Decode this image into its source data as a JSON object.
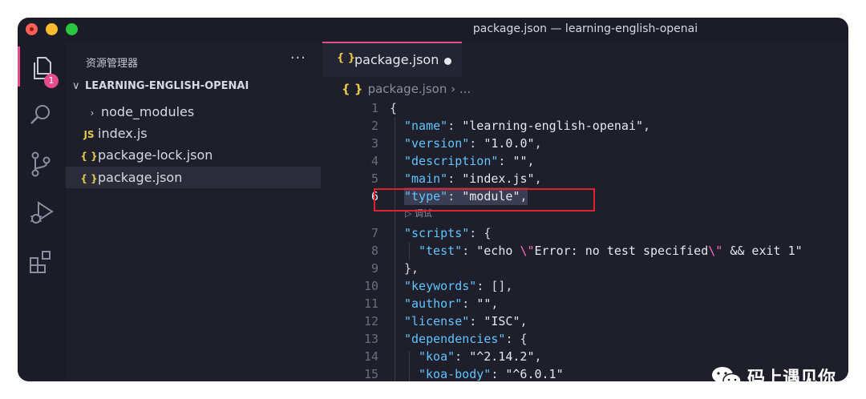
{
  "window": {
    "title": "package.json — learning-english-openai"
  },
  "activity_bar": {
    "items": [
      {
        "icon": "files-icon",
        "badge": "1",
        "active": true
      },
      {
        "icon": "search-icon"
      },
      {
        "icon": "source-control-icon"
      },
      {
        "icon": "run-debug-icon"
      },
      {
        "icon": "extensions-icon"
      }
    ]
  },
  "sidebar": {
    "title": "资源管理器",
    "more": "···",
    "root": "LEARNING-ENGLISH-OPENAI",
    "items": [
      {
        "label": "node_modules",
        "icon": "chevron-right-icon"
      },
      {
        "label": "index.js",
        "icon_text": "JS"
      },
      {
        "label": "package-lock.json",
        "icon_text": "{ }"
      },
      {
        "label": "package.json",
        "icon_text": "{ }",
        "selected": true
      }
    ]
  },
  "editor": {
    "tab": {
      "icon_text": "{ }",
      "label": "package.json",
      "dirty": true
    },
    "breadcrumb": {
      "icon_text": "{ }",
      "file": "package.json",
      "rest": "› ..."
    },
    "codelens": "▷ 调试",
    "lines": [
      {
        "n": "1",
        "code": "{"
      },
      {
        "n": "2",
        "code": "\"name\": \"learning-english-openai\","
      },
      {
        "n": "3",
        "code": "\"version\": \"1.0.0\","
      },
      {
        "n": "4",
        "code": "\"description\": \"\","
      },
      {
        "n": "5",
        "code": "\"main\": \"index.js\","
      },
      {
        "n": "6",
        "code": "\"type\": \"module\","
      },
      {
        "n": "7",
        "code": "\"scripts\": {"
      },
      {
        "n": "8",
        "code": "\"test\": \"echo \\\"Error: no test specified\\\" && exit 1\""
      },
      {
        "n": "9",
        "code": "},"
      },
      {
        "n": "10",
        "code": "\"keywords\": [],"
      },
      {
        "n": "11",
        "code": "\"author\": \"\","
      },
      {
        "n": "12",
        "code": "\"license\": \"ISC\","
      },
      {
        "n": "13",
        "code": "\"dependencies\": {"
      },
      {
        "n": "14",
        "code": "\"koa\": \"^2.14.2\","
      },
      {
        "n": "15",
        "code": "\"koa-body\": \"^6.0.1\""
      }
    ]
  },
  "watermark": {
    "text": "码上遇见你",
    "icon": "wechat-icon"
  },
  "colors": {
    "accent": "#e64c8a",
    "key": "#5fc4ff",
    "highlight_box": "#e0222f"
  }
}
